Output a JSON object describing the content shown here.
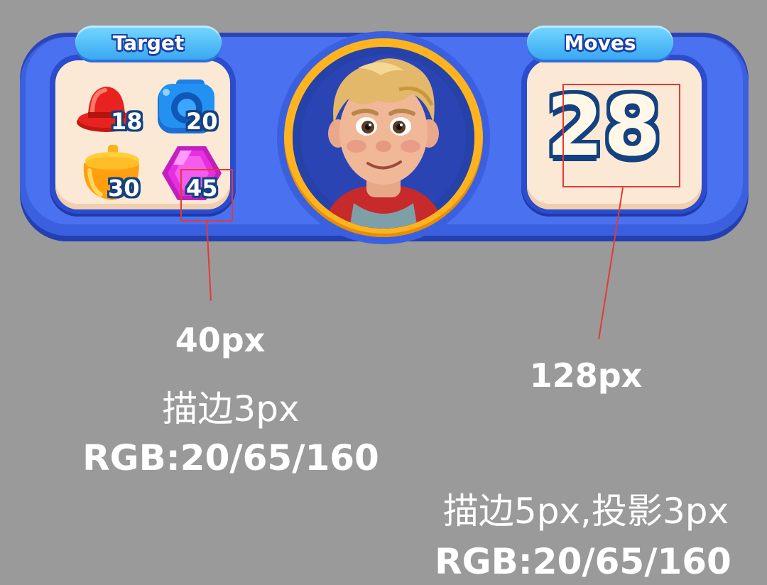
{
  "hud": {
    "target_label": "Target",
    "moves_label": "Moves",
    "moves_count": "28",
    "targets": [
      {
        "icon": "red-hat-icon",
        "count": "18",
        "color": "#e8231f"
      },
      {
        "icon": "blue-camera-icon",
        "count": "20",
        "color": "#1f7fe8"
      },
      {
        "icon": "yellow-pot-icon",
        "count": "30",
        "color": "#ffb11c"
      },
      {
        "icon": "magenta-gem-icon",
        "count": "45",
        "color": "#e82fe0"
      }
    ],
    "avatar": "blond-boy-avatar-icon"
  },
  "annotations": {
    "left_size": "40px",
    "left_stroke": "描边3px",
    "left_rgb": "RGB:20/65/160",
    "right_size": "128px",
    "right_stroke": "描边5px,投影3px",
    "right_rgb": "RGB:20/65/160"
  },
  "colors": {
    "background": "#9a9a9a",
    "hud_blue": "#3b60df",
    "panel_cream": "#fbe9d6",
    "outline": "#144180",
    "annotation_red": "#e53935"
  }
}
